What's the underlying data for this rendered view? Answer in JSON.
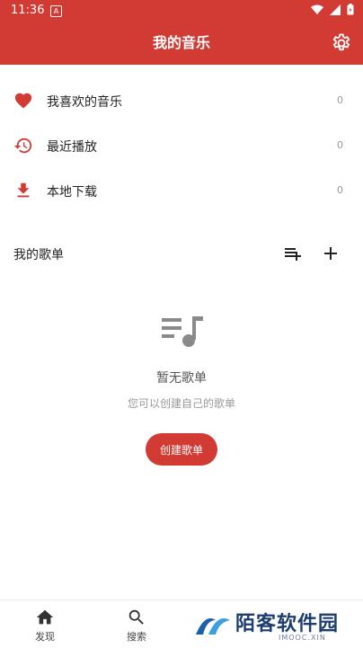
{
  "status_bar": {
    "time": "11:36",
    "notification_badge": "A"
  },
  "header": {
    "title": "我的音乐",
    "settings_icon": "gear-icon"
  },
  "menu": [
    {
      "label": "我喜欢的音乐",
      "count": "0",
      "icon": "heart-icon"
    },
    {
      "label": "最近播放",
      "count": "0",
      "icon": "history-icon"
    },
    {
      "label": "本地下载",
      "count": "0",
      "icon": "download-icon"
    }
  ],
  "playlists": {
    "title": "我的歌单",
    "empty_title": "暂无歌单",
    "empty_subtitle": "您可以创建自己的歌单",
    "create_label": "创建歌单"
  },
  "bottom_nav": [
    {
      "label": "发现",
      "icon": "home-icon"
    },
    {
      "label": "搜索",
      "icon": "search-icon"
    }
  ],
  "watermark": {
    "text": "陌客软件园",
    "sub": "IMOOC.XIN"
  },
  "colors": {
    "accent": "#d13b34",
    "text": "#222222",
    "muted": "#999999"
  }
}
